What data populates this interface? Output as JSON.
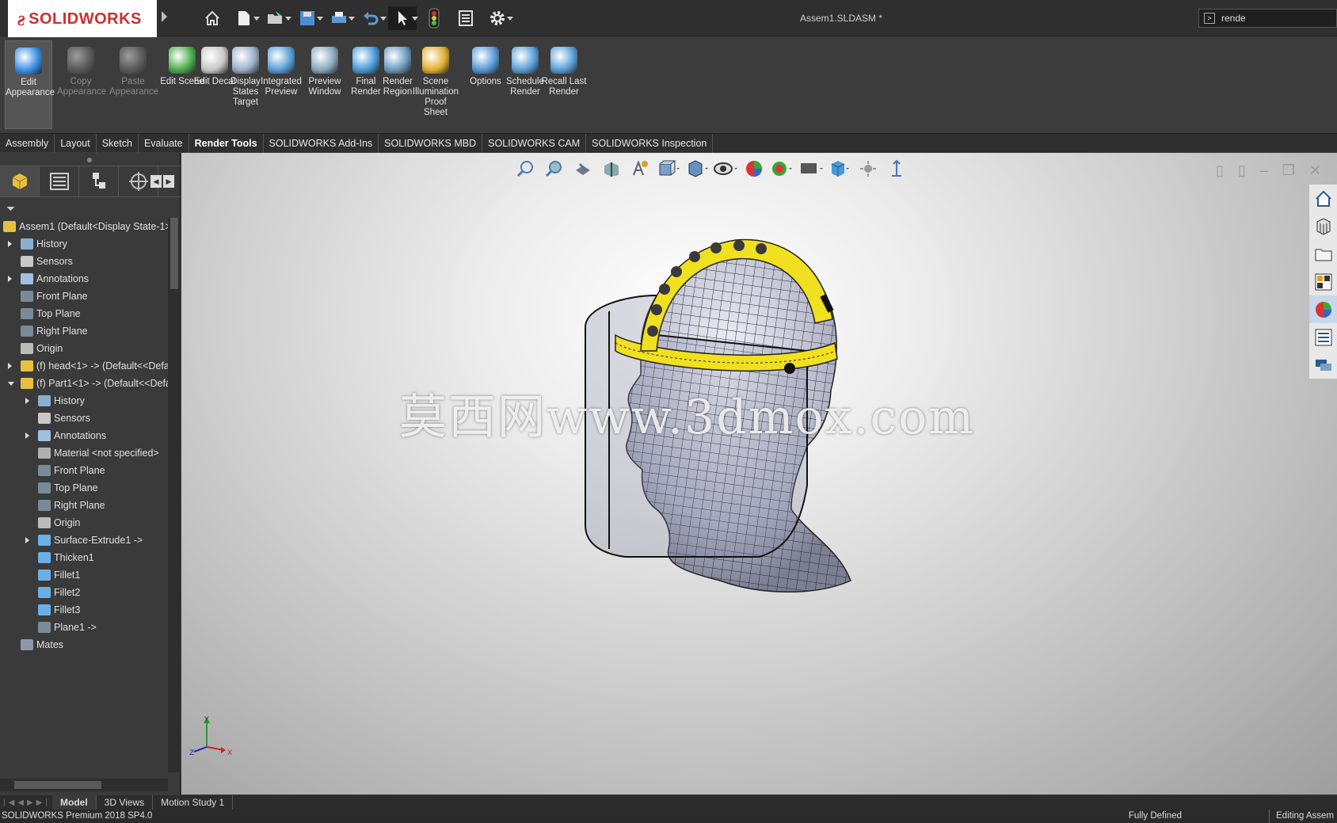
{
  "app": {
    "logo": "SOLIDWORKS",
    "document_title": "Assem1.SLDASM *",
    "search": {
      "value": "rende"
    }
  },
  "ribbon": [
    {
      "label": "Edit Appearance",
      "state": "active",
      "icon": "appearance-ball-icon",
      "color": "#3a8ee6"
    },
    {
      "label": "Copy Appearance",
      "state": "disabled",
      "icon": "copy-appearance-icon",
      "color": "#777777"
    },
    {
      "label": "Paste Appearance",
      "state": "disabled",
      "icon": "paste-appearance-icon",
      "color": "#777777"
    },
    {
      "label": "Edit Scene",
      "state": "normal",
      "icon": "edit-scene-icon",
      "color": "#4caf50"
    },
    {
      "label": "Edit Decal",
      "state": "normal",
      "icon": "edit-decal-icon",
      "color": "#c8c8c8"
    },
    {
      "label": "Display States Target",
      "state": "normal",
      "icon": "target-icon",
      "color": "#9ab0c8"
    },
    {
      "label": "Integrated Preview",
      "state": "normal",
      "icon": "integrated-preview-icon",
      "color": "#5aa0d8"
    },
    {
      "label": "Preview Window",
      "state": "normal",
      "icon": "preview-window-icon",
      "color": "#8aa8c0"
    },
    {
      "label": "Final Render",
      "state": "normal",
      "icon": "final-render-icon",
      "color": "#4a9ad8"
    },
    {
      "label": "Render Region",
      "state": "normal",
      "icon": "render-region-icon",
      "color": "#6a9ac0"
    },
    {
      "label": "Scene Illumination Proof Sheet",
      "state": "normal",
      "icon": "illumination-icon",
      "color": "#e0b030"
    },
    {
      "label": "Options",
      "state": "normal",
      "icon": "options-icon",
      "color": "#5a9ad8"
    },
    {
      "label": "Schedule Render",
      "state": "normal",
      "icon": "schedule-render-icon",
      "color": "#5aa0d8"
    },
    {
      "label": "Recall Last Render",
      "state": "normal",
      "icon": "recall-render-icon",
      "color": "#5aa0d8"
    }
  ],
  "tabs": [
    {
      "label": "Assembly",
      "active": false
    },
    {
      "label": "Layout",
      "active": false
    },
    {
      "label": "Sketch",
      "active": false
    },
    {
      "label": "Evaluate",
      "active": false
    },
    {
      "label": "Render Tools",
      "active": true
    },
    {
      "label": "SOLIDWORKS Add-Ins",
      "active": false
    },
    {
      "label": "SOLIDWORKS MBD",
      "active": false
    },
    {
      "label": "SOLIDWORKS CAM",
      "active": false
    },
    {
      "label": "SOLIDWORKS Inspection",
      "active": false
    }
  ],
  "tree": [
    {
      "label": "Assem1  (Default<Display State-1>",
      "level": 0,
      "expander": "none",
      "icon": "assembly-icon"
    },
    {
      "label": "History",
      "level": 1,
      "expander": "closed",
      "icon": "history-icon"
    },
    {
      "label": "Sensors",
      "level": 1,
      "expander": "none",
      "icon": "sensor-icon"
    },
    {
      "label": "Annotations",
      "level": 1,
      "expander": "closed",
      "icon": "annotation-icon"
    },
    {
      "label": "Front Plane",
      "level": 1,
      "expander": "none",
      "icon": "plane-icon"
    },
    {
      "label": "Top Plane",
      "level": 1,
      "expander": "none",
      "icon": "plane-icon"
    },
    {
      "label": "Right Plane",
      "level": 1,
      "expander": "none",
      "icon": "plane-icon"
    },
    {
      "label": "Origin",
      "level": 1,
      "expander": "none",
      "icon": "origin-icon"
    },
    {
      "label": "(f) head<1> -> (Default<<Defa",
      "level": 1,
      "expander": "closed",
      "icon": "part-icon"
    },
    {
      "label": "(f) Part1<1> -> (Default<<Defa",
      "level": 1,
      "expander": "open",
      "icon": "part-icon"
    },
    {
      "label": "History",
      "level": 2,
      "expander": "closed",
      "icon": "history-icon"
    },
    {
      "label": "Sensors",
      "level": 2,
      "expander": "none",
      "icon": "sensor-icon"
    },
    {
      "label": "Annotations",
      "level": 2,
      "expander": "closed",
      "icon": "annotation-icon"
    },
    {
      "label": "Material <not specified>",
      "level": 2,
      "expander": "none",
      "icon": "material-icon"
    },
    {
      "label": "Front Plane",
      "level": 2,
      "expander": "none",
      "icon": "plane-icon"
    },
    {
      "label": "Top Plane",
      "level": 2,
      "expander": "none",
      "icon": "plane-icon"
    },
    {
      "label": "Right Plane",
      "level": 2,
      "expander": "none",
      "icon": "plane-icon"
    },
    {
      "label": "Origin",
      "level": 2,
      "expander": "none",
      "icon": "origin-icon"
    },
    {
      "label": "Surface-Extrude1 ->",
      "level": 2,
      "expander": "closed",
      "icon": "surface-extrude-icon"
    },
    {
      "label": "Thicken1",
      "level": 2,
      "expander": "none",
      "icon": "thicken-icon"
    },
    {
      "label": "Fillet1",
      "level": 2,
      "expander": "none",
      "icon": "fillet-icon"
    },
    {
      "label": "Fillet2",
      "level": 2,
      "expander": "none",
      "icon": "fillet-icon"
    },
    {
      "label": "Fillet3",
      "level": 2,
      "expander": "none",
      "icon": "fillet-icon"
    },
    {
      "label": "Plane1 ->",
      "level": 2,
      "expander": "none",
      "icon": "plane-icon"
    },
    {
      "label": "Mates",
      "level": 1,
      "expander": "none",
      "icon": "mates-icon"
    }
  ],
  "viewport": {
    "watermark": "莫西网www.3dmox.com",
    "triad": {
      "x": "X",
      "y": "Y",
      "z": "Z"
    }
  },
  "bottom_tabs": [
    {
      "label": "Model",
      "active": true
    },
    {
      "label": "3D Views",
      "active": false
    },
    {
      "label": "Motion Study 1",
      "active": false
    }
  ],
  "status": {
    "version": "SOLIDWORKS Premium 2018 SP4.0",
    "state": "Fully Defined",
    "mode": "Editing Assem"
  }
}
